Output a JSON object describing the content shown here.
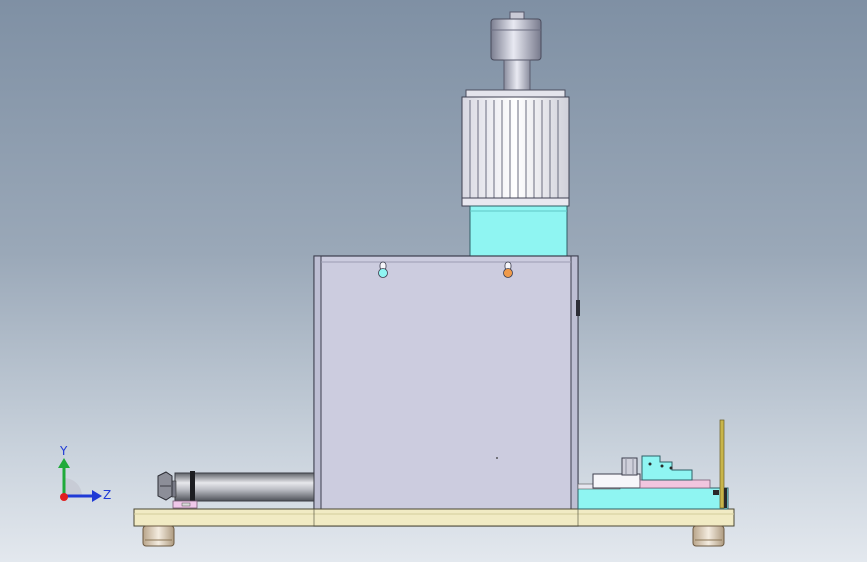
{
  "viewport": {
    "background_top": "#7f90a4",
    "background_bottom": "#e3e8ee"
  },
  "triad": {
    "y_label": "Y",
    "z_label": "Z",
    "y_color": "#1faa3a",
    "z_color": "#1f3ad6",
    "origin_color": "#e01f1f"
  },
  "model": {
    "housing_color": "#ccccdf",
    "base_color": "#f1ebc4",
    "accent_color": "#8ff5f2",
    "motor_color": "#f6f6fa"
  }
}
